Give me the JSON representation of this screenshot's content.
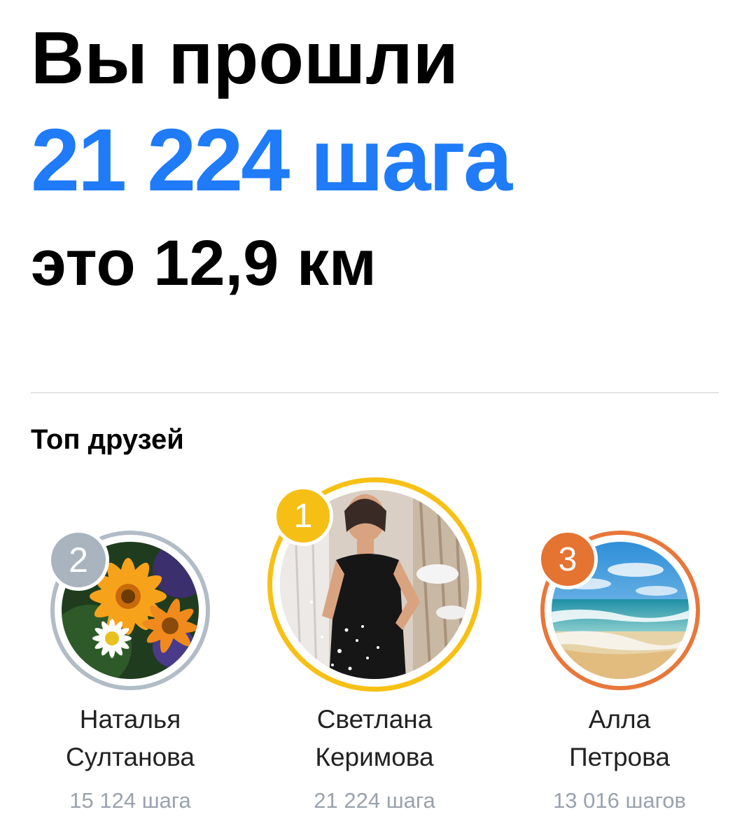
{
  "header": {
    "line1": "Вы прошли",
    "line2": "21 224 шага",
    "line3": "это 12,9 км"
  },
  "friends_section": {
    "title": "Топ друзей",
    "friends": [
      {
        "rank": "2",
        "name_first": "Наталья",
        "name_last": "Султанова",
        "steps": "15 124 шага",
        "ring_color": "#b1bcc6",
        "badge_color": "#aab4be"
      },
      {
        "rank": "1",
        "name_first": "Светлана",
        "name_last": "Керимова",
        "steps": "21 224 шага",
        "ring_color": "#f7c014",
        "badge_color": "#f5bf15"
      },
      {
        "rank": "3",
        "name_first": "Алла",
        "name_last": "Петрова",
        "steps": "13 016 шагов",
        "ring_color": "#e8773a",
        "badge_color": "#e57332"
      }
    ]
  },
  "colors": {
    "accent": "#1f7bf7",
    "text": "#000000",
    "secondary_text": "#99a2ad",
    "divider": "#e3e4e6"
  }
}
